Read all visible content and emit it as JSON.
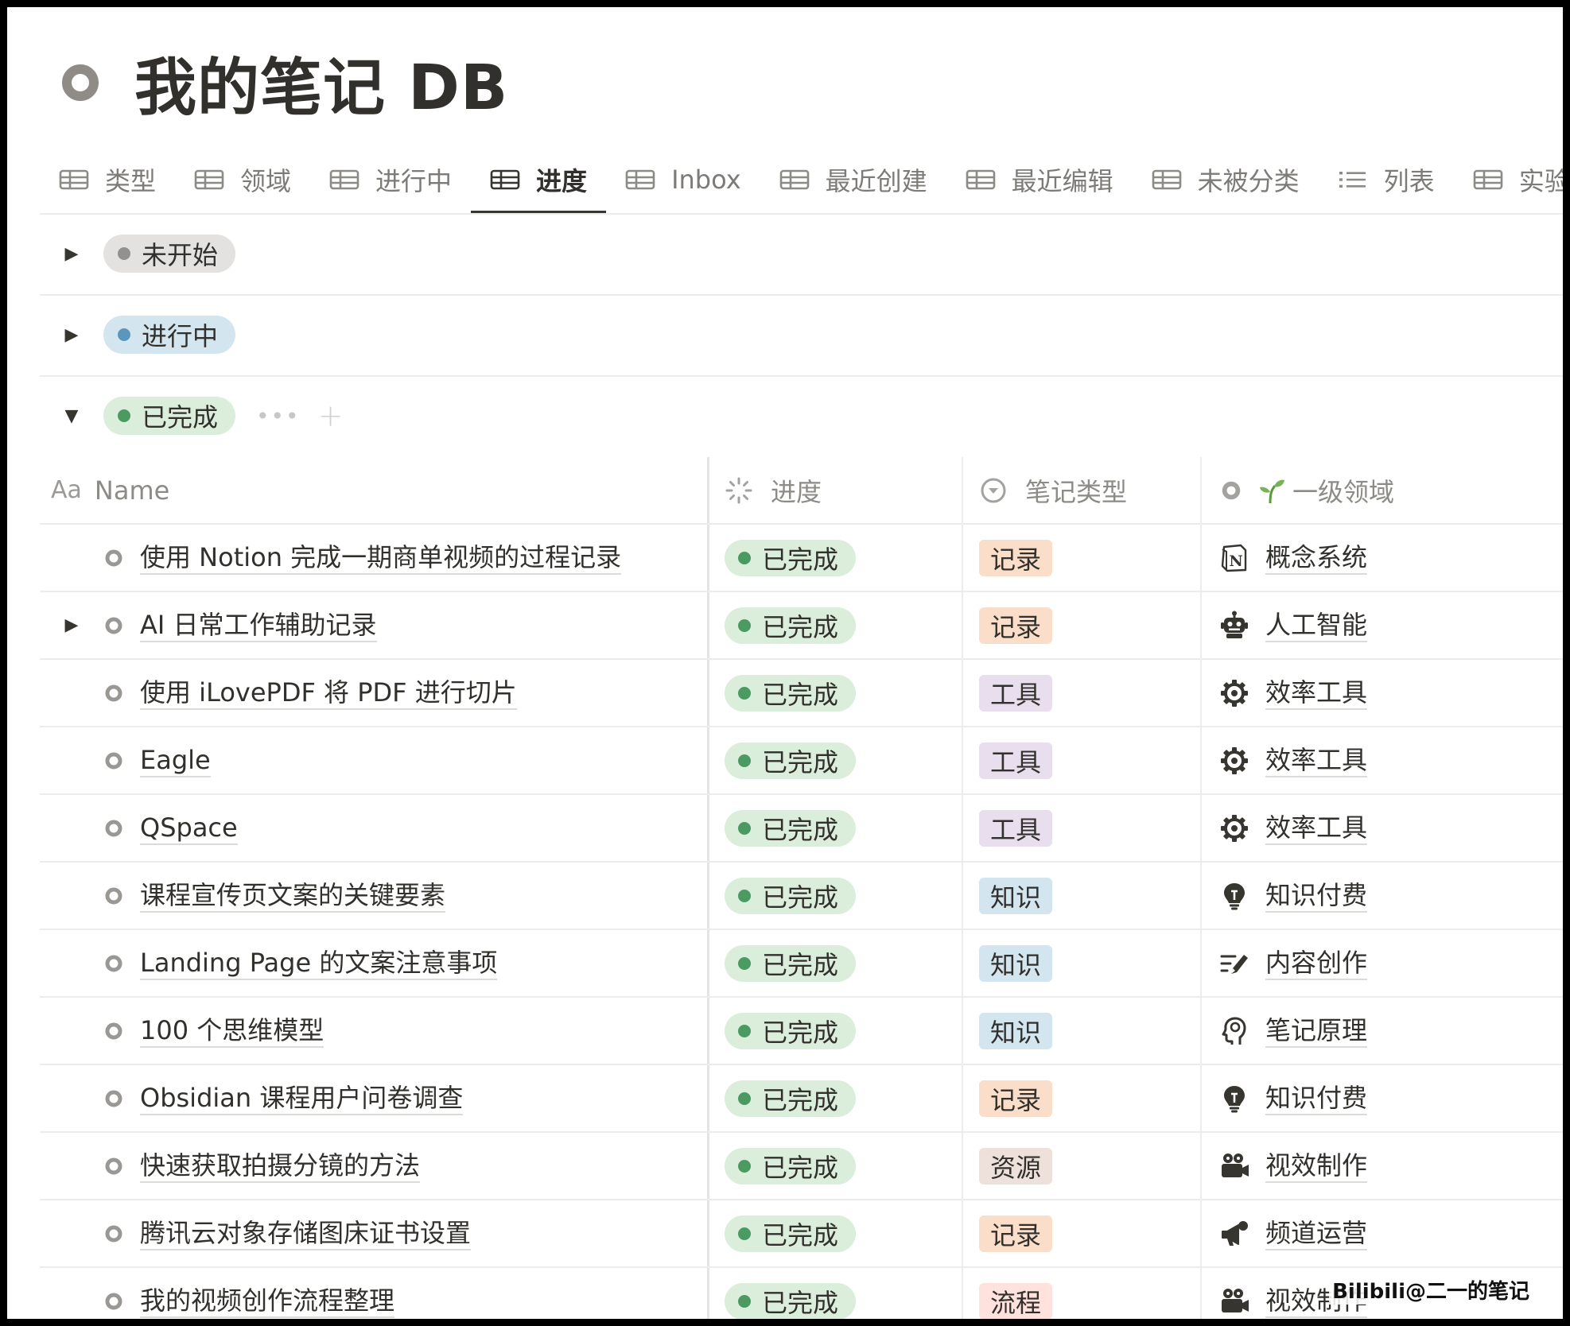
{
  "page": {
    "title": "我的笔记 DB",
    "icon": "ring-icon"
  },
  "tabs": [
    {
      "label": "类型",
      "icon": "table-icon",
      "active": false
    },
    {
      "label": "领域",
      "icon": "table-icon",
      "active": false
    },
    {
      "label": "进行中",
      "icon": "table-icon",
      "active": false
    },
    {
      "label": "进度",
      "icon": "table-icon",
      "active": true
    },
    {
      "label": "Inbox",
      "icon": "table-icon",
      "active": false
    },
    {
      "label": "最近创建",
      "icon": "table-icon",
      "active": false
    },
    {
      "label": "最近编辑",
      "icon": "table-icon",
      "active": false
    },
    {
      "label": "未被分类",
      "icon": "table-icon",
      "active": false
    },
    {
      "label": "列表",
      "icon": "list-icon",
      "active": false
    },
    {
      "label": "实验",
      "icon": "table-icon",
      "active": false
    }
  ],
  "groups": [
    {
      "label": "未开始",
      "expanded": false,
      "pill_bg": "#e3e2e0",
      "dot": "#91918e"
    },
    {
      "label": "进行中",
      "expanded": false,
      "pill_bg": "#d3e5ef",
      "dot": "#5b97bd"
    },
    {
      "label": "已完成",
      "expanded": true,
      "pill_bg": "#dbeddb",
      "dot": "#4a9a61",
      "more": "•••",
      "add": "+"
    }
  ],
  "table": {
    "headers": {
      "name_prefix": "Aa",
      "name": "Name",
      "progress": "进度",
      "note_type": "笔记类型",
      "area": "一级领域"
    },
    "rows": [
      {
        "name": "使用 Notion 完成一期商单视频的过程记录",
        "progress": "已完成",
        "type": "记录",
        "area": "概念系统",
        "area_icon": "notion-logo-icon",
        "expandable": false
      },
      {
        "name": "AI 日常工作辅助记录",
        "progress": "已完成",
        "type": "记录",
        "area": "人工智能",
        "area_icon": "robot-icon",
        "expandable": true
      },
      {
        "name": "使用 iLovePDF 将 PDF 进行切片",
        "progress": "已完成",
        "type": "工具",
        "area": "效率工具",
        "area_icon": "gear-icon",
        "expandable": false
      },
      {
        "name": "Eagle",
        "progress": "已完成",
        "type": "工具",
        "area": "效率工具",
        "area_icon": "gear-icon",
        "expandable": false
      },
      {
        "name": "QSpace",
        "progress": "已完成",
        "type": "工具",
        "area": "效率工具",
        "area_icon": "gear-icon",
        "expandable": false
      },
      {
        "name": "课程宣传页文案的关键要素",
        "progress": "已完成",
        "type": "知识",
        "area": "知识付费",
        "area_icon": "lightbulb-icon",
        "expandable": false
      },
      {
        "name": "Landing Page 的文案注意事项",
        "progress": "已完成",
        "type": "知识",
        "area": "内容创作",
        "area_icon": "write-icon",
        "expandable": false
      },
      {
        "name": "100 个思维模型",
        "progress": "已完成",
        "type": "知识",
        "area": "笔记原理",
        "area_icon": "head-icon",
        "expandable": false
      },
      {
        "name": "Obsidian 课程用户问卷调查",
        "progress": "已完成",
        "type": "记录",
        "area": "知识付费",
        "area_icon": "lightbulb-icon",
        "expandable": false
      },
      {
        "name": "快速获取拍摄分镜的方法",
        "progress": "已完成",
        "type": "资源",
        "area": "视效制作",
        "area_icon": "video-camera-icon",
        "expandable": false
      },
      {
        "name": "腾讯云对象存储图床证书设置",
        "progress": "已完成",
        "type": "记录",
        "area": "频道运营",
        "area_icon": "megaphone-icon",
        "expandable": false
      },
      {
        "name": "我的视频创作流程整理",
        "progress": "已完成",
        "type": "流程",
        "area": "视效制作",
        "area_icon": "video-camera-icon",
        "expandable": false
      }
    ]
  },
  "tag_colors": {
    "记录": "#fadec9",
    "工具": "#e8deee",
    "知识": "#d3e5ef",
    "资源": "#eee0da",
    "流程": "#ffe2dd"
  },
  "watermark": "Bilibili@二一的笔记"
}
